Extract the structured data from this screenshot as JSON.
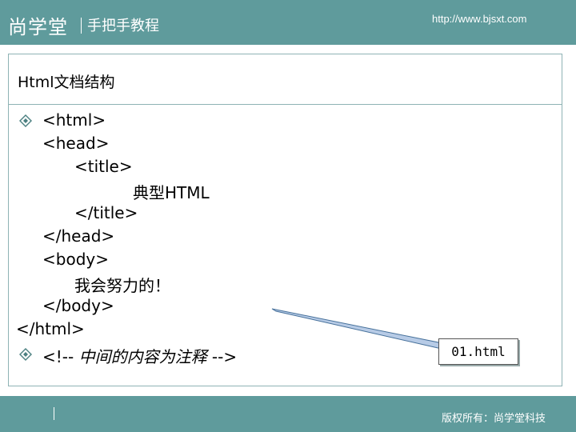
{
  "header": {
    "brand": "尚学堂",
    "tagline": "手把手教程",
    "url": "http://www.bjsxt.com"
  },
  "slide": {
    "title": "Html文档结构",
    "code": {
      "l1": "<html>",
      "l2": "<head>",
      "l3": "<title>",
      "l4": "典型HTML",
      "l5": "</title>",
      "l6": "</head>",
      "l7": "<body>",
      "l8": "我会努力的！",
      "l9": "</body>",
      "l10": "</html>"
    },
    "comment_open": "<!-- ",
    "comment_text": "中间的内容为注释",
    "comment_close": " -->",
    "bullet_icon": "diamond-bullet-icon",
    "callout": "01.html"
  },
  "footer": {
    "copyright": "版权所有：尚学堂科技"
  },
  "colors": {
    "bar": "#5f9b9c",
    "frame": "#8eb3b4",
    "pointer": "#b7cbe6"
  }
}
